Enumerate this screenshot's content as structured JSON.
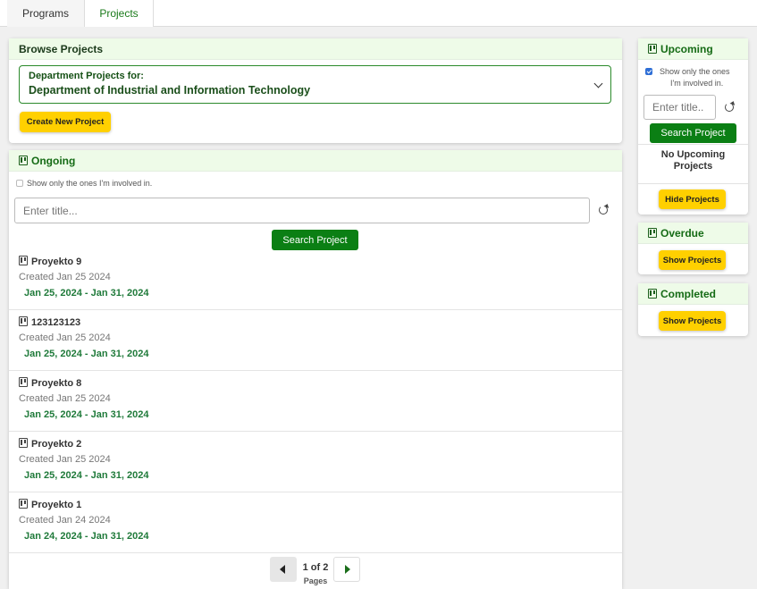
{
  "tabs": {
    "programs": "Programs",
    "projects": "Projects"
  },
  "browse": {
    "header": "Browse Projects",
    "dept_label": "Department Projects for:",
    "dept_value": "Department of Industrial and Information Technology",
    "create_button": "Create New Project"
  },
  "ongoing": {
    "header": "Ongoing",
    "involved_label": "Show only the ones I'm involved in.",
    "search_placeholder": "Enter title...",
    "search_button": "Search Project",
    "projects": [
      {
        "title": "Proyekto 9",
        "created": "Created Jan 25 2024",
        "dates": "Jan 25, 2024 - Jan 31, 2024"
      },
      {
        "title": "123123123",
        "created": "Created Jan 25 2024",
        "dates": "Jan 25, 2024 - Jan 31, 2024"
      },
      {
        "title": "Proyekto 8",
        "created": "Created Jan 25 2024",
        "dates": "Jan 25, 2024 - Jan 31, 2024"
      },
      {
        "title": "Proyekto 2",
        "created": "Created Jan 25 2024",
        "dates": "Jan 25, 2024 - Jan 31, 2024"
      },
      {
        "title": "Proyekto 1",
        "created": "Created Jan 24 2024",
        "dates": "Jan 24, 2024 - Jan 31, 2024"
      }
    ],
    "pager": {
      "text": "1 of 2",
      "sub": "Pages"
    }
  },
  "upcoming": {
    "header": "Upcoming",
    "involved_label_1": "Show only the ones",
    "involved_label_2": "I'm involved in.",
    "search_placeholder": "Enter title..",
    "search_button": "Search Project",
    "empty_1": "No Upcoming",
    "empty_2": "Projects",
    "toggle_button": "Hide Projects"
  },
  "overdue": {
    "header": "Overdue",
    "toggle_button": "Show Projects"
  },
  "completed": {
    "header": "Completed",
    "toggle_button": "Show Projects"
  },
  "colors": {
    "accent_green": "#0b7f14",
    "button_yellow": "#ffd000",
    "header_bg": "#eefbe8",
    "date_green": "#1f7a3a"
  }
}
